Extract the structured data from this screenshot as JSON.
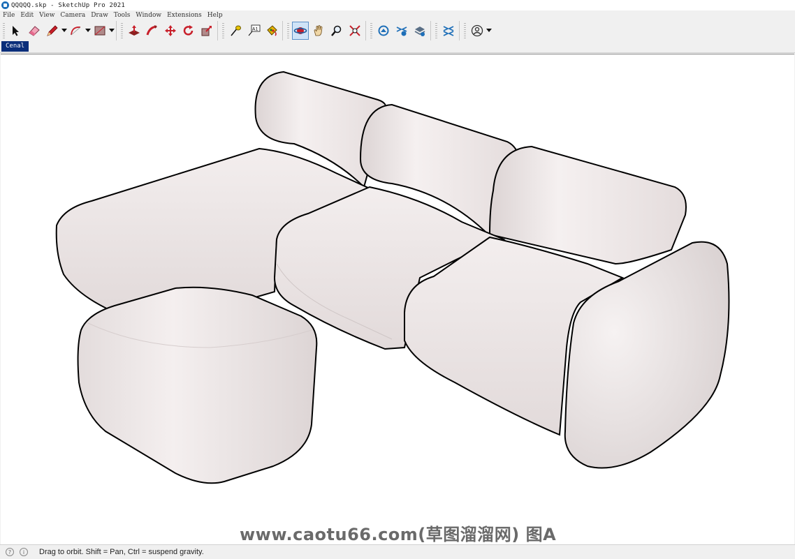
{
  "window": {
    "title": "QQQQQ.skp - SketchUp Pro 2021",
    "app_icon": "sketchup-icon"
  },
  "menu": [
    "File",
    "Edit",
    "View",
    "Camera",
    "Draw",
    "Tools",
    "Window",
    "Extensions",
    "Help"
  ],
  "toolbar": {
    "tools": [
      {
        "name": "select",
        "icon": "arrow-cursor-icon"
      },
      {
        "name": "eraser",
        "icon": "eraser-icon"
      },
      {
        "name": "line",
        "icon": "pencil-icon"
      },
      {
        "name": "arc",
        "icon": "arc-icon"
      },
      {
        "name": "rectangle",
        "icon": "rectangle-icon"
      },
      {
        "name": "push-pull",
        "icon": "push-pull-icon"
      },
      {
        "name": "follow-me",
        "icon": "follow-me-icon"
      },
      {
        "name": "move",
        "icon": "move-icon"
      },
      {
        "name": "rotate",
        "icon": "rotate-icon"
      },
      {
        "name": "scale",
        "icon": "scale-icon"
      },
      {
        "name": "tape-measure",
        "icon": "tape-measure-icon"
      },
      {
        "name": "text",
        "icon": "text-icon",
        "label": "A1"
      },
      {
        "name": "paint-bucket",
        "icon": "paint-bucket-icon"
      },
      {
        "name": "orbit",
        "icon": "orbit-icon",
        "active": true
      },
      {
        "name": "pan",
        "icon": "pan-hand-icon"
      },
      {
        "name": "zoom",
        "icon": "zoom-icon"
      },
      {
        "name": "zoom-extents",
        "icon": "zoom-extents-icon"
      },
      {
        "name": "3d-warehouse",
        "icon": "warehouse-icon"
      },
      {
        "name": "extension-warehouse",
        "icon": "extension-warehouse-icon"
      },
      {
        "name": "layout",
        "icon": "layout-icon"
      },
      {
        "name": "extension-manager",
        "icon": "extension-manager-icon"
      },
      {
        "name": "account",
        "icon": "user-account-icon"
      }
    ]
  },
  "scene_tab": {
    "label": "Cenal"
  },
  "viewport": {
    "model": "sectional-sofa-model",
    "watermark": "www.caotu66.com(草图溜溜网) 图A"
  },
  "status": {
    "message": "Drag to orbit. Shift = Pan, Ctrl = suspend gravity.",
    "icons": [
      "geo-location-icon",
      "info-icon"
    ]
  },
  "colors": {
    "accent": "#0a2e7a",
    "active_tool": "#cfe3f7",
    "sofa": "#eae4e4"
  }
}
